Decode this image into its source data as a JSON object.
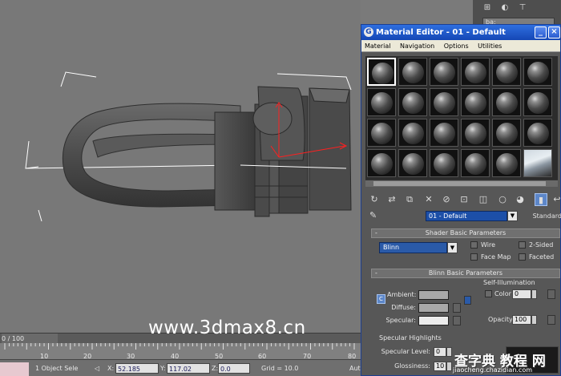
{
  "command_panel": {
    "icons": [
      "create-icon",
      "modify-icon",
      "hierarchy-icon"
    ],
    "field_text": "ba:"
  },
  "material_editor": {
    "title": "Material Editor - 01 - Default",
    "window_buttons": [
      "_",
      "×"
    ],
    "menu": [
      "Material",
      "Navigation",
      "Options",
      "Utilities"
    ],
    "toolbar_icons": [
      "get-material-icon",
      "put-to-scene-icon",
      "assign-material-icon",
      "reset-icon",
      "make-unique-icon",
      "put-to-library-icon",
      "material-id-icon",
      "show-map-icon",
      "show-end-result-icon",
      "go-to-parent-icon"
    ],
    "material_name": "01 - Default",
    "material_type": "Standard",
    "shader_basic": {
      "header": "Shader Basic Parameters",
      "shader": "Blinn",
      "options": [
        "Wire",
        "2-Sided",
        "Face Map",
        "Faceted"
      ]
    },
    "blinn_basic": {
      "header": "Blinn Basic Parameters",
      "self_illum_label": "Self-Illumination",
      "color_label": "Color",
      "color_value": "0",
      "ambient_label": "Ambient:",
      "diffuse_label": "Diffuse:",
      "specular_label": "Specular:",
      "opacity_label": "Opacity:",
      "opacity_value": "100",
      "lock_symbol": "C",
      "ambient_color": "#a8a8a8",
      "diffuse_color": "#a8a8a8",
      "specular_color": "#ececec"
    },
    "specular_highlights": {
      "label": "Specular Highlights",
      "level_label": "Specular Level:",
      "level_value": "0",
      "gloss_label": "Glossiness:",
      "gloss_value": "10"
    }
  },
  "timeline": {
    "frame": "0 / 100",
    "ticks": [
      "10",
      "20",
      "30",
      "40",
      "50",
      "60",
      "70",
      "80"
    ]
  },
  "status": {
    "selection": "1 Object Sele",
    "x_label": "X:",
    "x_value": "52.185",
    "y_label": "Y:",
    "y_value": "117.02",
    "z_label": "Z:",
    "z_value": "0.0",
    "grid": "Grid = 10.0",
    "auto": "Aut"
  },
  "watermarks": {
    "main": "www.3dmax8.cn",
    "logo": "查字典 教程 网",
    "url": "jiaocheng.chazidian.com"
  }
}
